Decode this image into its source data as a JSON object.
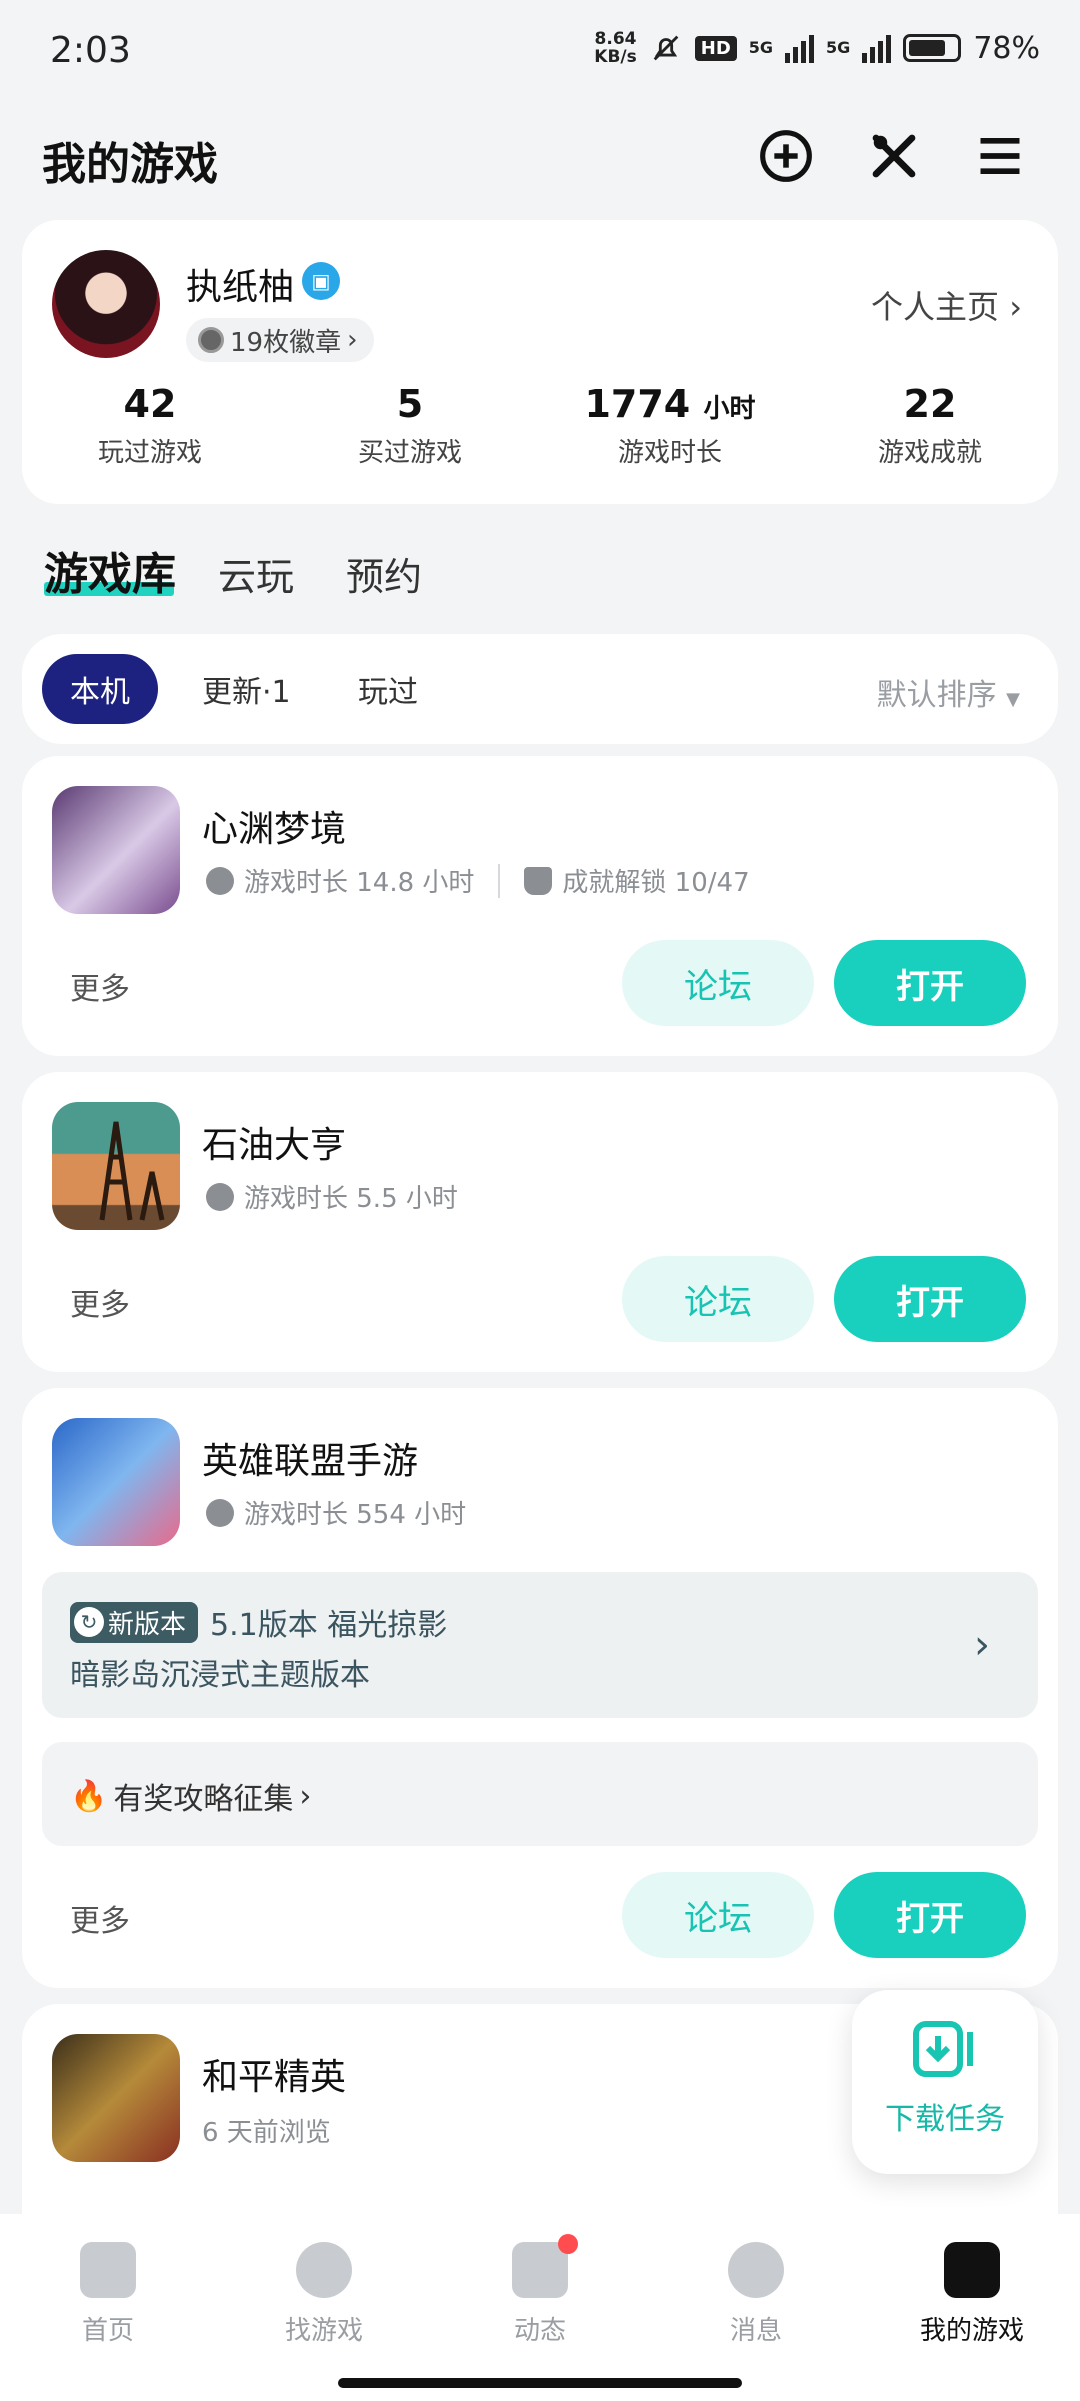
{
  "status_bar": {
    "time": "2:03",
    "speed_value": "8.64",
    "speed_unit": "KB/s",
    "hd": "HD",
    "net1": "5G",
    "net2": "5G",
    "battery": "78%",
    "battery_level": 0.78
  },
  "header": {
    "title": "我的游戏",
    "icons": [
      "plus-circle-icon",
      "tools-icon",
      "menu-icon"
    ]
  },
  "profile": {
    "name": "执纸柚",
    "badges": "19枚徽章",
    "home_link": "个人主页",
    "stats": [
      {
        "value": "42",
        "unit": "",
        "label": "玩过游戏"
      },
      {
        "value": "5",
        "unit": "",
        "label": "买过游戏"
      },
      {
        "value": "1774",
        "unit": "小时",
        "label": "游戏时长"
      },
      {
        "value": "22",
        "unit": "",
        "label": "游戏成就"
      }
    ]
  },
  "tabs": [
    "游戏库",
    "云玩",
    "预约"
  ],
  "filters": {
    "chips": [
      "本机",
      "更新·1",
      "玩过"
    ],
    "sort": "默认排序"
  },
  "games": [
    {
      "name": "心渊梦境",
      "playtime": "游戏时长 14.8 小时",
      "achievement": "成就解锁 10/47",
      "more": "更多",
      "forum": "论坛",
      "open": "打开"
    },
    {
      "name": "石油大亨",
      "playtime": "游戏时长 5.5 小时",
      "more": "更多",
      "forum": "论坛",
      "open": "打开"
    },
    {
      "name": "英雄联盟手游",
      "playtime": "游戏时长 554 小时",
      "new_tag": "新版本",
      "update_title": "5.1版本 福光掠影",
      "update_sub": "暗影岛沉浸式主题版本",
      "reward": "有奖攻略征集",
      "more": "更多",
      "forum": "论坛",
      "open": "打开"
    },
    {
      "name": "和平精英",
      "playtime": "6 天前浏览"
    }
  ],
  "float_download": {
    "label": "下载任务"
  },
  "bottom_nav": [
    {
      "label": "首页",
      "icon": "home-icon"
    },
    {
      "label": "找游戏",
      "icon": "planet-icon"
    },
    {
      "label": "动态",
      "icon": "feed-icon"
    },
    {
      "label": "消息",
      "icon": "message-icon"
    },
    {
      "label": "我的游戏",
      "icon": "gamepad-icon"
    }
  ],
  "colors": {
    "accent": "#18d0bd",
    "chip_active": "#1d2180",
    "background": "#f2f4f5"
  }
}
